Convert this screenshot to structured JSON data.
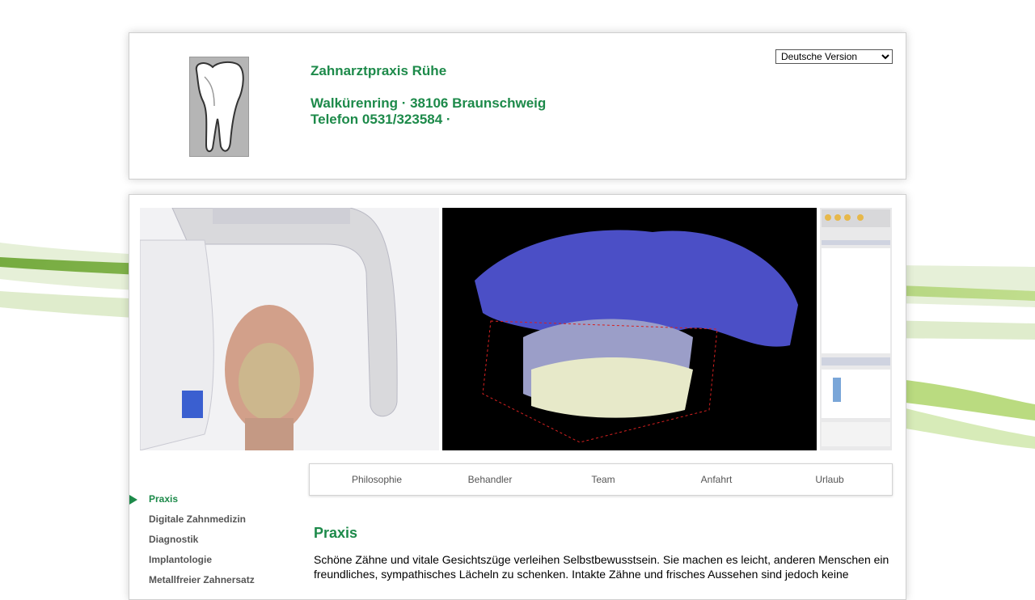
{
  "header": {
    "practice_name": "Zahnarztpraxis Rühe",
    "address": "Walkürenring · 38106 Braunschweig",
    "phone": "Telefon 0531/323584 ·",
    "language_selected": "Deutsche Version",
    "language_options": [
      "Deutsche Version"
    ]
  },
  "sub_nav": {
    "items": [
      "Philosophie",
      "Behandler",
      "Team",
      "Anfahrt",
      "Urlaub"
    ]
  },
  "side_nav": {
    "items": [
      "Praxis",
      "Digitale Zahnmedizin",
      "Diagnostik",
      "Implantologie",
      "Metallfreier Zahnersatz"
    ],
    "active": "Praxis"
  },
  "content": {
    "title": "Praxis",
    "text": "Schöne Zähne und vitale Gesichtszüge verleihen Selbstbewusstsein. Sie machen es leicht, anderen Menschen ein freundliches, sympathisches Lächeln zu schenken. Intakte Zähne und frisches Aussehen sind jedoch keine"
  },
  "colors": {
    "accent_green": "#1d8a4a",
    "nav_text": "#555555"
  }
}
